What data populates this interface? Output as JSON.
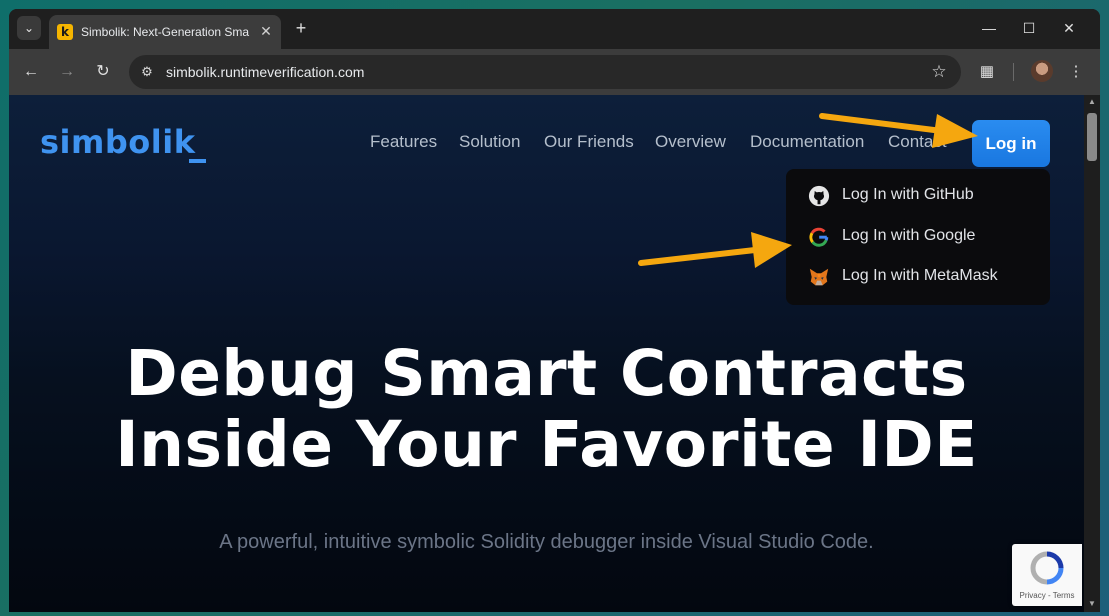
{
  "browser": {
    "tab_title": "Simbolik: Next-Generation Sma",
    "favicon_letter": "k",
    "url": "simbolik.runtimeverification.com",
    "icons": {
      "tab_search": "chevron-down-icon",
      "close": "close-icon",
      "new_tab": "plus-icon",
      "minimize": "minimize-icon",
      "maximize": "maximize-icon",
      "window_close": "close-icon",
      "back": "back-arrow-icon",
      "forward": "forward-arrow-icon",
      "reload": "reload-icon",
      "site_info": "site-info-icon",
      "bookmark": "star-icon",
      "extensions": "puzzle-icon",
      "menu": "kebab-menu-icon"
    }
  },
  "page": {
    "logo": "simbolik",
    "nav": [
      "Features",
      "Solution",
      "Our Friends",
      "Overview",
      "Documentation",
      "Contact"
    ],
    "login_label": "Log in",
    "login_menu": [
      {
        "label": "Log In with GitHub",
        "icon": "github-icon"
      },
      {
        "label": "Log In with Google",
        "icon": "google-icon"
      },
      {
        "label": "Log In with MetaMask",
        "icon": "metamask-icon"
      }
    ],
    "hero_line1": "Debug Smart Contracts",
    "hero_line2": "Inside Your Favorite IDE",
    "subtitle": "A powerful, intuitive symbolic Solidity debugger inside Visual Studio Code.",
    "recaptcha_label": "Privacy - Terms",
    "accent_color": "#3f93f0",
    "annotation_color": "#f5a70f"
  }
}
